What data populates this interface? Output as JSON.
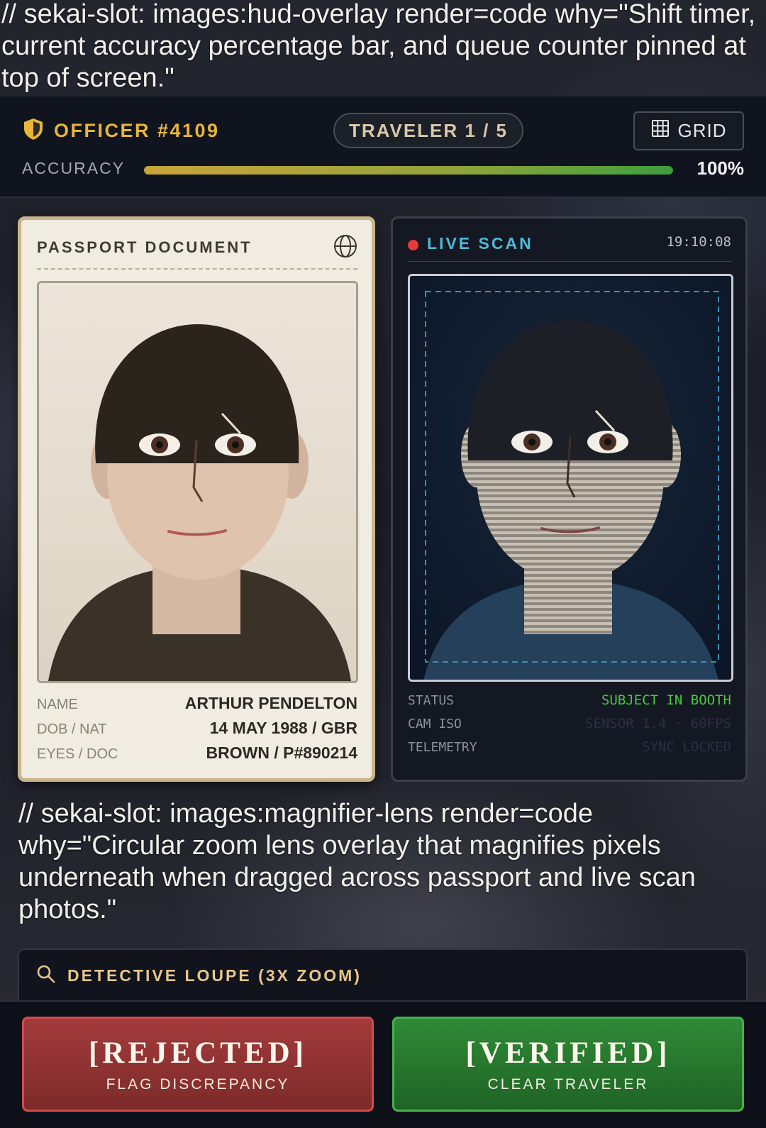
{
  "slots": {
    "hud_overlay_note": "// sekai-slot: images:hud-overlay render=code why=\"Shift timer, current accuracy percentage bar, and queue counter pinned at top of screen.\"",
    "magnifier_note": "// sekai-slot: images:magnifier-lens render=code why=\"Circular zoom lens overlay that magnifies pixels underneath when dragged across passport and live scan photos.\""
  },
  "hud": {
    "officer": "OFFICER #4109",
    "traveler_counter": "TRAVELER 1 / 5",
    "grid_button": "GRID",
    "accuracy_label": "ACCURACY",
    "accuracy_value": "100%",
    "accuracy_fraction": 1.0,
    "icons": {
      "officer": "shield-icon",
      "grid": "grid-icon"
    }
  },
  "passport": {
    "title": "PASSPORT DOCUMENT",
    "icon": "globe-icon",
    "fields": [
      {
        "key": "NAME",
        "value": "ARTHUR PENDELTON"
      },
      {
        "key": "DOB / NAT",
        "value": "14 MAY 1988 / GBR"
      },
      {
        "key": "EYES / DOC",
        "value": "BROWN / P#890214"
      }
    ]
  },
  "live_scan": {
    "title": "LIVE SCAN",
    "time": "19:10:08",
    "fields": [
      {
        "key": "STATUS",
        "value": "SUBJECT IN BOOTH"
      },
      {
        "key": "CAM ISO",
        "value": "SENSOR 1.4 · 60FPS"
      },
      {
        "key": "TELEMETRY",
        "value": "SYNC LOCKED"
      }
    ]
  },
  "loupe": {
    "label": "DETECTIVE LOUPE (3X ZOOM)",
    "icon": "magnifier-icon"
  },
  "actions": {
    "reject": {
      "label": "[REJECTED]",
      "sub": "FLAG DISCREPANCY"
    },
    "verify": {
      "label": "[VERIFIED]",
      "sub": "CLEAR TRAVELER"
    }
  },
  "colors": {
    "officer_gold": "#e8b53a",
    "scan_cyan": "#4fb9d6",
    "status_green": "#48c93a",
    "reject_red": "#a33b3b",
    "verify_green": "#2f8a35"
  }
}
